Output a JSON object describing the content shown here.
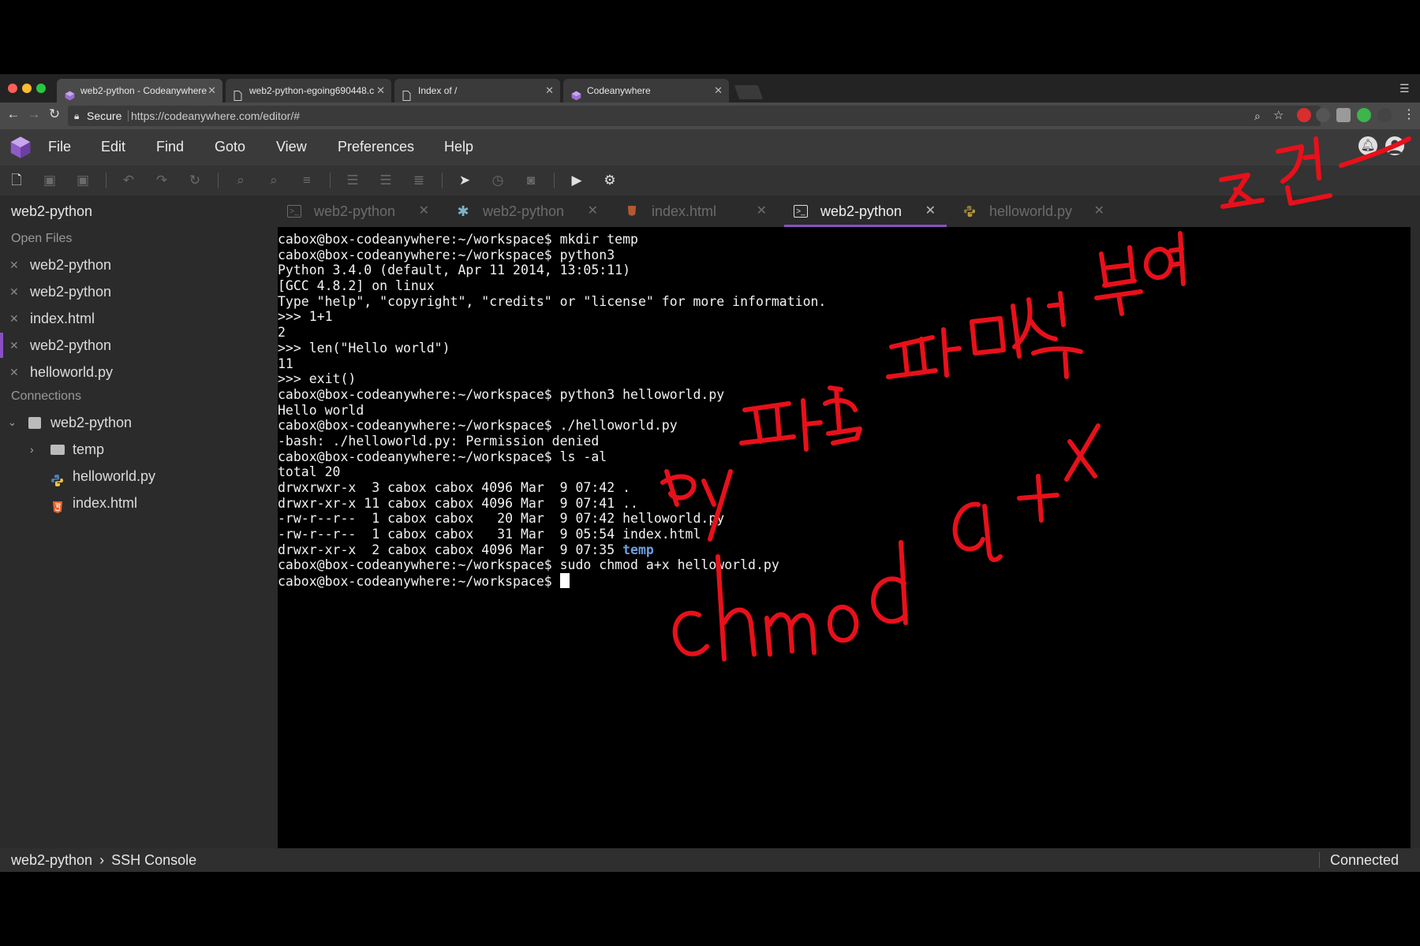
{
  "browser": {
    "tabs": [
      {
        "title": "web2-python - Codeanywhere",
        "icon": "codeanywhere-cube-icon",
        "active": true
      },
      {
        "title": "web2-python-egoing690448.c",
        "icon": "document-icon",
        "active": false
      },
      {
        "title": "Index of /",
        "icon": "document-icon",
        "active": false
      },
      {
        "title": "Codeanywhere",
        "icon": "codeanywhere-cube-icon",
        "active": false
      }
    ],
    "secure_label": "Secure",
    "url": "https://codeanywhere.com/editor/#"
  },
  "menu": {
    "items": [
      "File",
      "Edit",
      "Find",
      "Goto",
      "View",
      "Preferences",
      "Help"
    ]
  },
  "sidebar": {
    "project_title": "web2-python",
    "open_files_label": "Open Files",
    "open_files": [
      "web2-python",
      "web2-python",
      "index.html",
      "web2-python",
      "helloworld.py"
    ],
    "connections_label": "Connections",
    "connection": "web2-python",
    "tree": [
      {
        "name": "temp",
        "type": "folder"
      },
      {
        "name": "helloworld.py",
        "type": "python"
      },
      {
        "name": "index.html",
        "type": "html"
      }
    ]
  },
  "editor_tabs": [
    {
      "label": "web2-python",
      "icon": "terminal-icon",
      "active": false
    },
    {
      "label": "web2-python",
      "icon": "asterisk-icon",
      "active": false
    },
    {
      "label": "index.html",
      "icon": "html5-icon",
      "active": false
    },
    {
      "label": "web2-python",
      "icon": "terminal-icon",
      "active": true
    },
    {
      "label": "helloworld.py",
      "icon": "python-icon",
      "active": false
    }
  ],
  "terminal": {
    "lines": [
      "cabox@box-codeanywhere:~/workspace$ mkdir temp",
      "cabox@box-codeanywhere:~/workspace$ python3",
      "Python 3.4.0 (default, Apr 11 2014, 13:05:11)",
      "[GCC 4.8.2] on linux",
      "Type \"help\", \"copyright\", \"credits\" or \"license\" for more information.",
      ">>> 1+1",
      "2",
      ">>> len(\"Hello world\")",
      "11",
      ">>> exit()",
      "cabox@box-codeanywhere:~/workspace$ python3 helloworld.py",
      "Hello world",
      "cabox@box-codeanywhere:~/workspace$ ./helloworld.py",
      "-bash: ./helloworld.py: Permission denied",
      "cabox@box-codeanywhere:~/workspace$ ls -al",
      "total 20",
      "drwxrwxr-x  3 cabox cabox 4096 Mar  9 07:42 .",
      "drwxr-xr-x 11 cabox cabox 4096 Mar  9 07:41 ..",
      "-rw-r--r--  1 cabox cabox   20 Mar  9 07:42 helloworld.py",
      "-rw-r--r--  1 cabox cabox   31 Mar  9 05:54 index.html",
      "cabox@box-codeanywhere:~/workspace$ sudo chmod a+x helloworld.py"
    ],
    "dir_line_prefix": "drwxr-xr-x  2 cabox cabox 4096 Mar  9 07:35 ",
    "dir_line_name": "temp",
    "prompt": "cabox@box-codeanywhere:~/workspace$ "
  },
  "status": {
    "breadcrumb_project": "web2-python",
    "breadcrumb_separator": "›",
    "breadcrumb_page": "SSH Console",
    "connection_state": "Connected"
  },
  "annotation": {
    "color": "#e8101a",
    "text_line1": "py 파일 퍼미션 부여 조건",
    "text_line2": "chmod a+x"
  }
}
